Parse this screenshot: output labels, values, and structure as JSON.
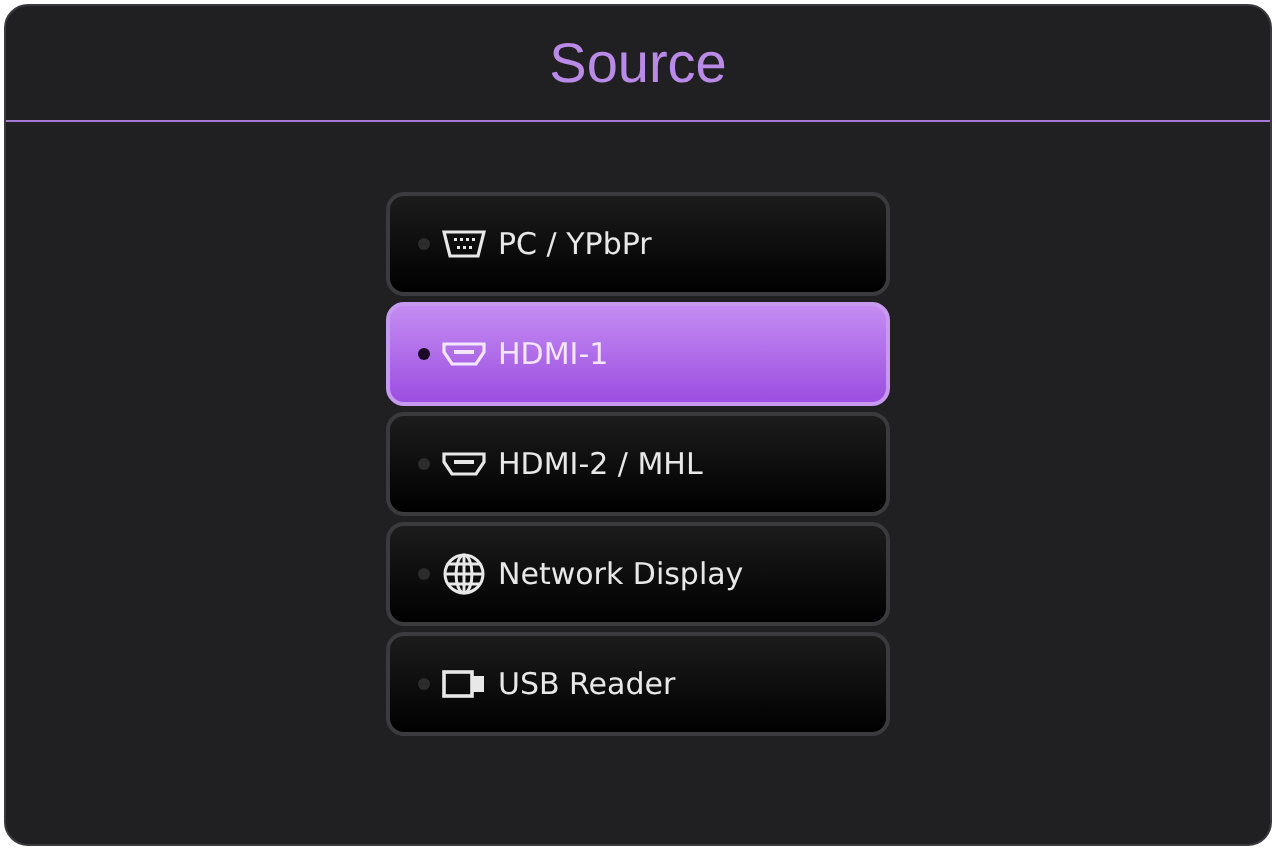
{
  "window": {
    "title": "Source"
  },
  "sources": [
    {
      "label": "PC / YPbPr",
      "kind": "vga",
      "selected": false
    },
    {
      "label": "HDMI-1",
      "kind": "hdmi",
      "selected": true
    },
    {
      "label": "HDMI-2 / MHL",
      "kind": "hdmi",
      "selected": false
    },
    {
      "label": "Network Display",
      "kind": "network",
      "selected": false
    },
    {
      "label": "USB Reader",
      "kind": "usb",
      "selected": false
    }
  ]
}
